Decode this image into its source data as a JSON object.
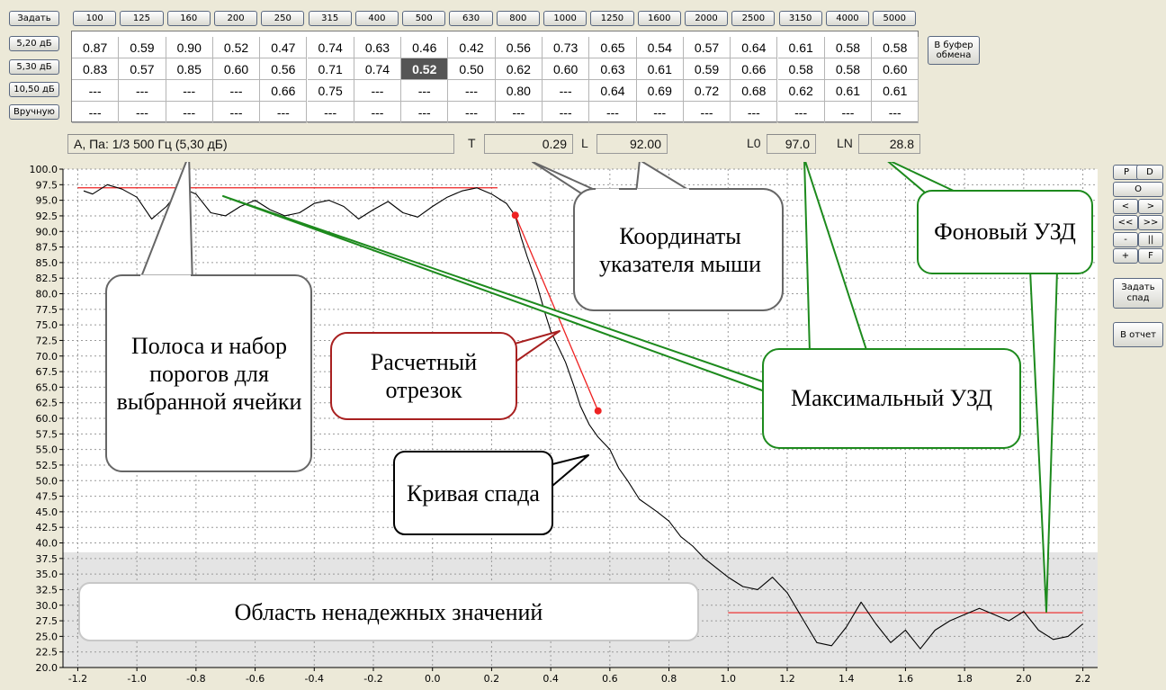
{
  "toolbar": {
    "set_label": "Задать"
  },
  "frequencies": [
    "100",
    "125",
    "160",
    "200",
    "250",
    "315",
    "400",
    "500",
    "630",
    "800",
    "1000",
    "1250",
    "1600",
    "2000",
    "2500",
    "3150",
    "4000",
    "5000"
  ],
  "rows": [
    {
      "label": "5,20 дБ",
      "values": [
        "0.87",
        "0.59",
        "0.90",
        "0.52",
        "0.47",
        "0.74",
        "0.63",
        "0.46",
        "0.42",
        "0.56",
        "0.73",
        "0.65",
        "0.54",
        "0.57",
        "0.64",
        "0.61",
        "0.58",
        "0.58"
      ]
    },
    {
      "label": "5,30 дБ",
      "values": [
        "0.83",
        "0.57",
        "0.85",
        "0.60",
        "0.56",
        "0.71",
        "0.74",
        "0.52",
        "0.50",
        "0.62",
        "0.60",
        "0.63",
        "0.61",
        "0.59",
        "0.66",
        "0.58",
        "0.58",
        "0.60"
      ]
    },
    {
      "label": "10,50 дБ",
      "values": [
        "---",
        "---",
        "---",
        "---",
        "0.66",
        "0.75",
        "---",
        "---",
        "---",
        "0.80",
        "---",
        "0.64",
        "0.69",
        "0.72",
        "0.68",
        "0.62",
        "0.61",
        "0.61"
      ]
    },
    {
      "label": "Вручную",
      "values": [
        "---",
        "---",
        "---",
        "---",
        "---",
        "---",
        "---",
        "---",
        "---",
        "---",
        "---",
        "---",
        "---",
        "---",
        "---",
        "---",
        "---",
        "---"
      ]
    }
  ],
  "selected_cell": {
    "row": 1,
    "col": 7
  },
  "clipboard_button": "В буфер обмена",
  "status": {
    "band_text": "А, Па: 1/3 500 Гц (5,30 дБ)",
    "t_label": "T",
    "t_value": "0.29",
    "l_label": "L",
    "l_value": "92.00",
    "l0_label": "L0",
    "l0_value": "97.0",
    "ln_label": "LN",
    "ln_value": "28.8"
  },
  "side_buttons": {
    "p": "P",
    "d": "D",
    "o": "O",
    "left": "<",
    "right": ">",
    "fast_left": "<<",
    "fast_right": ">>",
    "minus": "-",
    "pause": "||",
    "plus": "+",
    "f": "F",
    "set_decay": "Задать спад",
    "report": "В отчет"
  },
  "callouts": {
    "band": "Полоса и набор порогов для выбранной ячейки",
    "mouse": "Координаты указателя мыши",
    "background": "Фоновый УЗД",
    "calc": "Расчетный отрезок",
    "max": "Максимальный УЗД",
    "curve": "Кривая спада",
    "unreliable": "Область ненадежных значений"
  },
  "colors": {
    "fit_line": "#ee2222",
    "calc_callout": "#a82020",
    "level_callout": "#1d8a1d",
    "gray_callout": "#666666",
    "black_callout": "#000000",
    "unreliable_zone": "#e4e4e4"
  },
  "chart_data": {
    "type": "line",
    "xlim": [
      -1.25,
      2.25
    ],
    "ylim": [
      20.0,
      100.0
    ],
    "x_ticks": [
      "-1.2",
      "-1.0",
      "-0.8",
      "-0.6",
      "-0.4",
      "-0.2",
      "0.0",
      "0.2",
      "0.4",
      "0.6",
      "0.8",
      "1.0",
      "1.2",
      "1.4",
      "1.6",
      "1.8",
      "2.0",
      "2.2"
    ],
    "y_ticks": [
      "20.0",
      "22.5",
      "25.0",
      "27.5",
      "30.0",
      "32.5",
      "35.0",
      "37.5",
      "40.0",
      "42.5",
      "45.0",
      "47.5",
      "50.0",
      "52.5",
      "55.0",
      "57.5",
      "60.0",
      "62.5",
      "65.0",
      "67.5",
      "70.0",
      "72.5",
      "75.0",
      "77.5",
      "80.0",
      "82.5",
      "85.0",
      "87.5",
      "90.0",
      "92.5",
      "95.0",
      "97.5",
      "100.0"
    ],
    "grid": true,
    "unreliable_below": 38.5,
    "series": [
      {
        "role": "decay",
        "x": [
          -1.18,
          -1.15,
          -1.1,
          -1.05,
          -1.0,
          -0.95,
          -0.9,
          -0.85,
          -0.8,
          -0.75,
          -0.7,
          -0.65,
          -0.6,
          -0.55,
          -0.5,
          -0.45,
          -0.4,
          -0.35,
          -0.3,
          -0.25,
          -0.2,
          -0.15,
          -0.1,
          -0.05,
          0.0,
          0.05,
          0.1,
          0.15,
          0.2,
          0.25,
          0.28,
          0.3,
          0.32,
          0.35,
          0.38,
          0.4,
          0.42,
          0.45,
          0.48,
          0.5,
          0.53,
          0.56,
          0.6,
          0.63,
          0.66,
          0.7,
          0.73,
          0.76,
          0.8,
          0.84,
          0.88,
          0.92,
          0.96,
          1.0,
          1.05,
          1.1,
          1.15,
          1.2,
          1.25,
          1.3,
          1.35,
          1.4,
          1.45,
          1.5,
          1.55,
          1.6,
          1.65,
          1.7,
          1.75,
          1.8,
          1.85,
          1.9,
          1.95,
          2.0,
          2.05,
          2.1,
          2.15,
          2.2
        ],
        "y": [
          96.5,
          96.0,
          97.5,
          96.8,
          95.5,
          92.0,
          94.0,
          97.0,
          96.0,
          93.0,
          92.5,
          94.0,
          95.0,
          93.5,
          92.5,
          93.0,
          94.5,
          95.0,
          94.0,
          92.0,
          93.5,
          94.8,
          93.0,
          92.3,
          94.0,
          95.5,
          96.5,
          97.0,
          96.0,
          94.5,
          92.5,
          89.0,
          86.0,
          82.0,
          77.0,
          74.0,
          72.0,
          69.0,
          65.0,
          62.0,
          59.0,
          57.0,
          55.0,
          52.0,
          50.0,
          47.0,
          46.0,
          45.0,
          43.5,
          41.0,
          39.5,
          37.5,
          36.0,
          34.5,
          33.0,
          32.5,
          34.5,
          32.0,
          28.0,
          24.0,
          23.5,
          26.5,
          30.5,
          27.0,
          24.0,
          26.0,
          23.0,
          26.0,
          27.5,
          28.5,
          29.5,
          28.5,
          27.5,
          29.0,
          26.0,
          24.5,
          25.0,
          27.0
        ]
      },
      {
        "role": "max-level",
        "x": [
          -1.2,
          0.22
        ],
        "y": [
          97.0,
          97.0
        ]
      },
      {
        "role": "background-level",
        "x": [
          1.0,
          2.2
        ],
        "y": [
          28.8,
          28.8
        ]
      },
      {
        "role": "fit-segment",
        "x": [
          0.28,
          0.56
        ],
        "y": [
          92.6,
          61.2
        ]
      }
    ]
  }
}
